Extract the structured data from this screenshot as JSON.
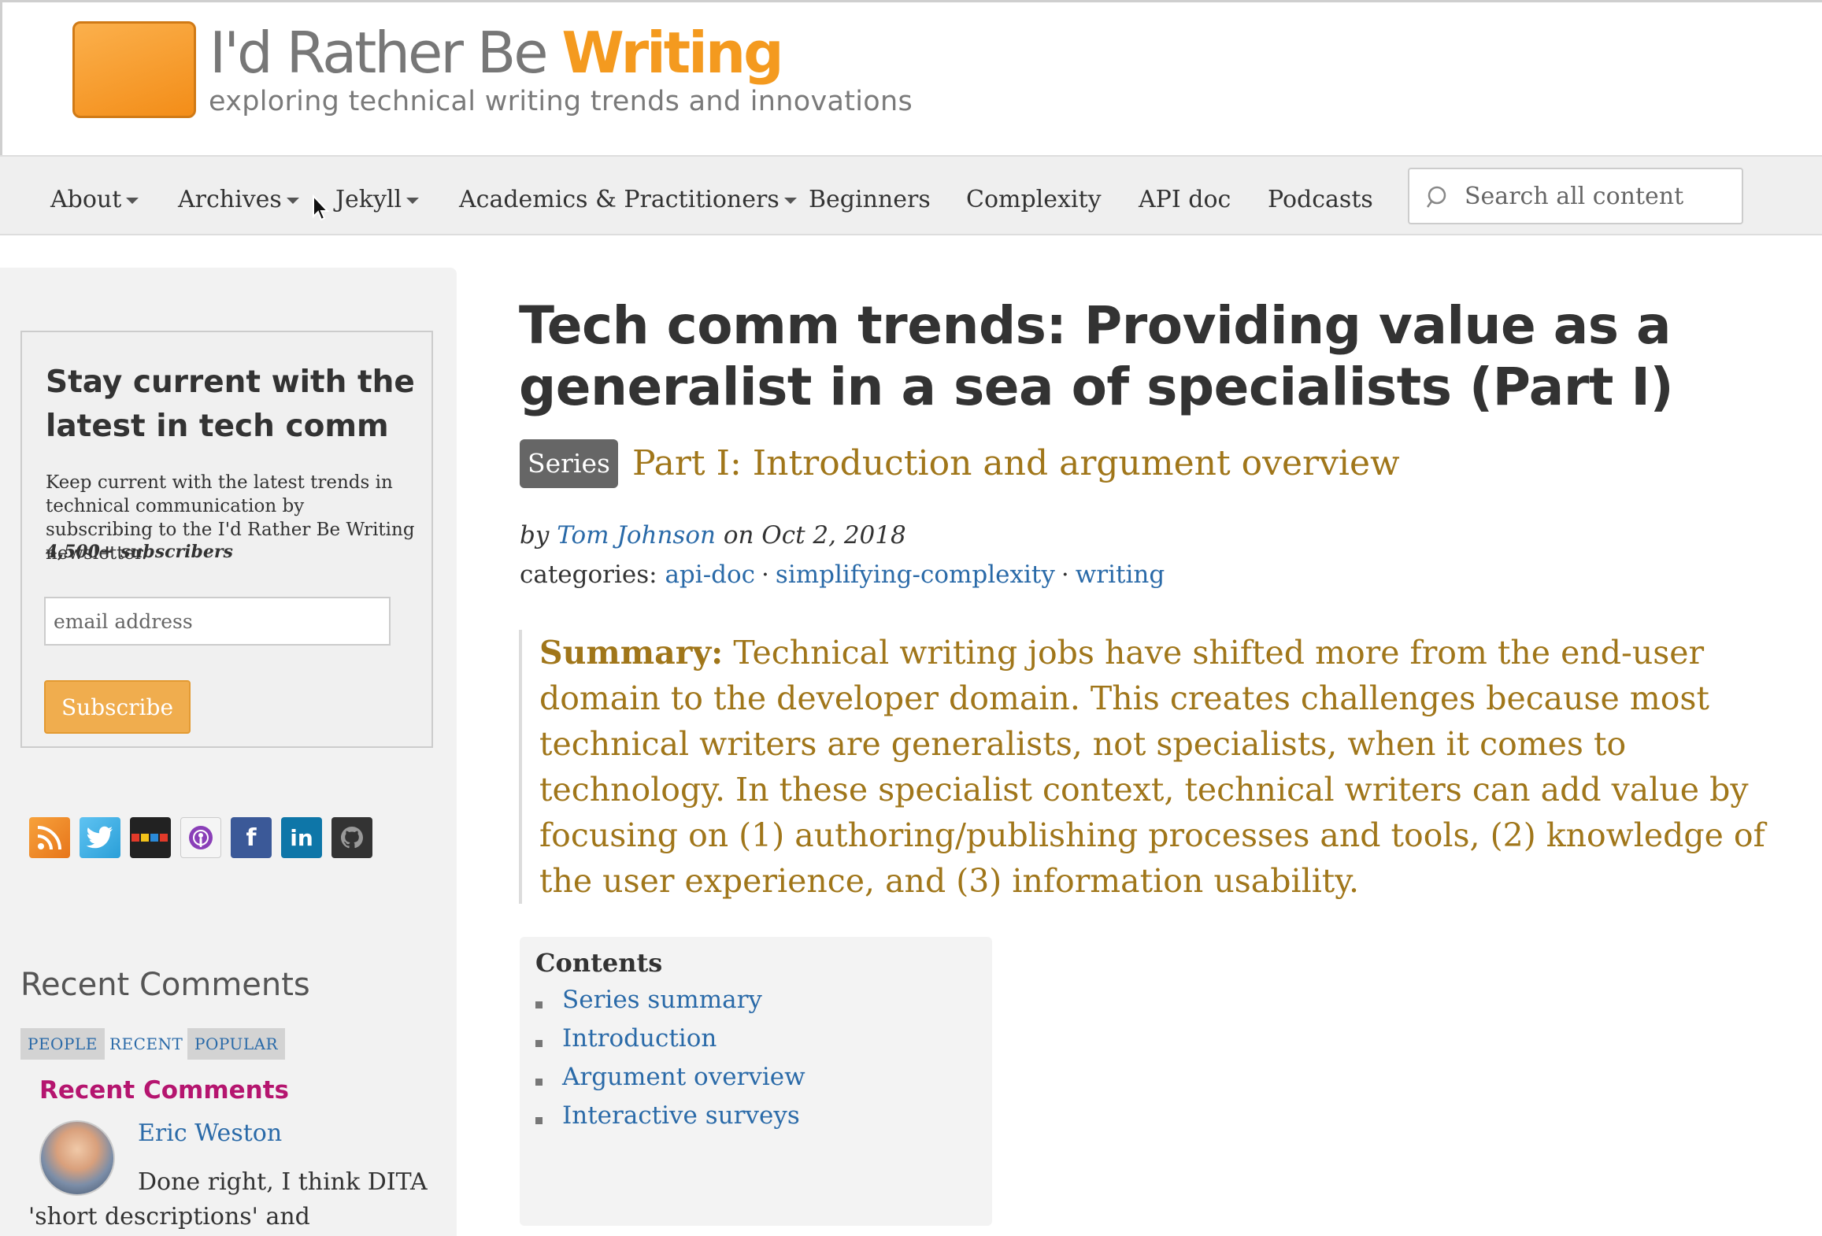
{
  "header": {
    "title_main": "I'd Rather Be ",
    "title_accent": "Writing",
    "tagline": "exploring technical writing trends and innovations"
  },
  "nav": {
    "items": [
      {
        "label": "About",
        "dropdown": true
      },
      {
        "label": "Archives",
        "dropdown": true
      },
      {
        "label": "Jekyll",
        "dropdown": true
      },
      {
        "label": "Academics & Practitioners",
        "dropdown": true
      },
      {
        "label": "Beginners",
        "dropdown": false
      },
      {
        "label": "Complexity",
        "dropdown": false
      },
      {
        "label": "API doc",
        "dropdown": false
      },
      {
        "label": "Podcasts",
        "dropdown": false
      }
    ],
    "search_placeholder": "Search all content"
  },
  "sidebar": {
    "newsletter": {
      "title": "Stay current with the latest in tech comm",
      "description": "Keep current with the latest trends in technical communication by subscribing to the I'd Rather Be Writing newsletter.",
      "subscribers": "4,500+ subscribers",
      "email_placeholder": "email address",
      "subscribe_label": "Subscribe"
    },
    "social_icons": [
      "rss-icon",
      "twitter-icon",
      "podcast-strip-icon",
      "podcast-icon",
      "facebook-icon",
      "linkedin-icon",
      "github-icon"
    ],
    "recent_comments": {
      "heading": "Recent Comments",
      "tabs": [
        "PEOPLE",
        "RECENT",
        "POPULAR"
      ],
      "subheading": "Recent Comments",
      "comment": {
        "author": "Eric Weston",
        "text": "Done right, I think DITA 'short descriptions' and"
      }
    }
  },
  "post": {
    "title": "Tech comm trends: Providing value as a generalist in a sea of specialists (Part I)",
    "series_badge": "Series",
    "series_title": "Part I: Introduction and argument overview",
    "by": "by ",
    "author": "Tom Johnson",
    "date_text": " on Oct 2, 2018",
    "categories_label": "categories: ",
    "categories": [
      "api-doc",
      "simplifying-complexity",
      "writing"
    ],
    "summary_label": "Summary:",
    "summary_text": " Technical writing jobs have shifted more from the end-user domain to the developer domain. This creates challenges because most technical writers are generalists, not specialists, when it comes to technology. In these specialist context, technical writers can add value by focusing on (1) authoring/publishing processes and tools, (2) knowledge of the user experience, and (3) information usability.",
    "contents": {
      "title": "Contents",
      "items": [
        "Series summary",
        "Introduction",
        "Argument overview",
        "Interactive surveys"
      ]
    }
  },
  "colors": {
    "accent_orange": "#f49a1f",
    "link_blue": "#2a6aa8",
    "summary_gold": "#a0761a",
    "comments_magenta": "#b5156f"
  }
}
